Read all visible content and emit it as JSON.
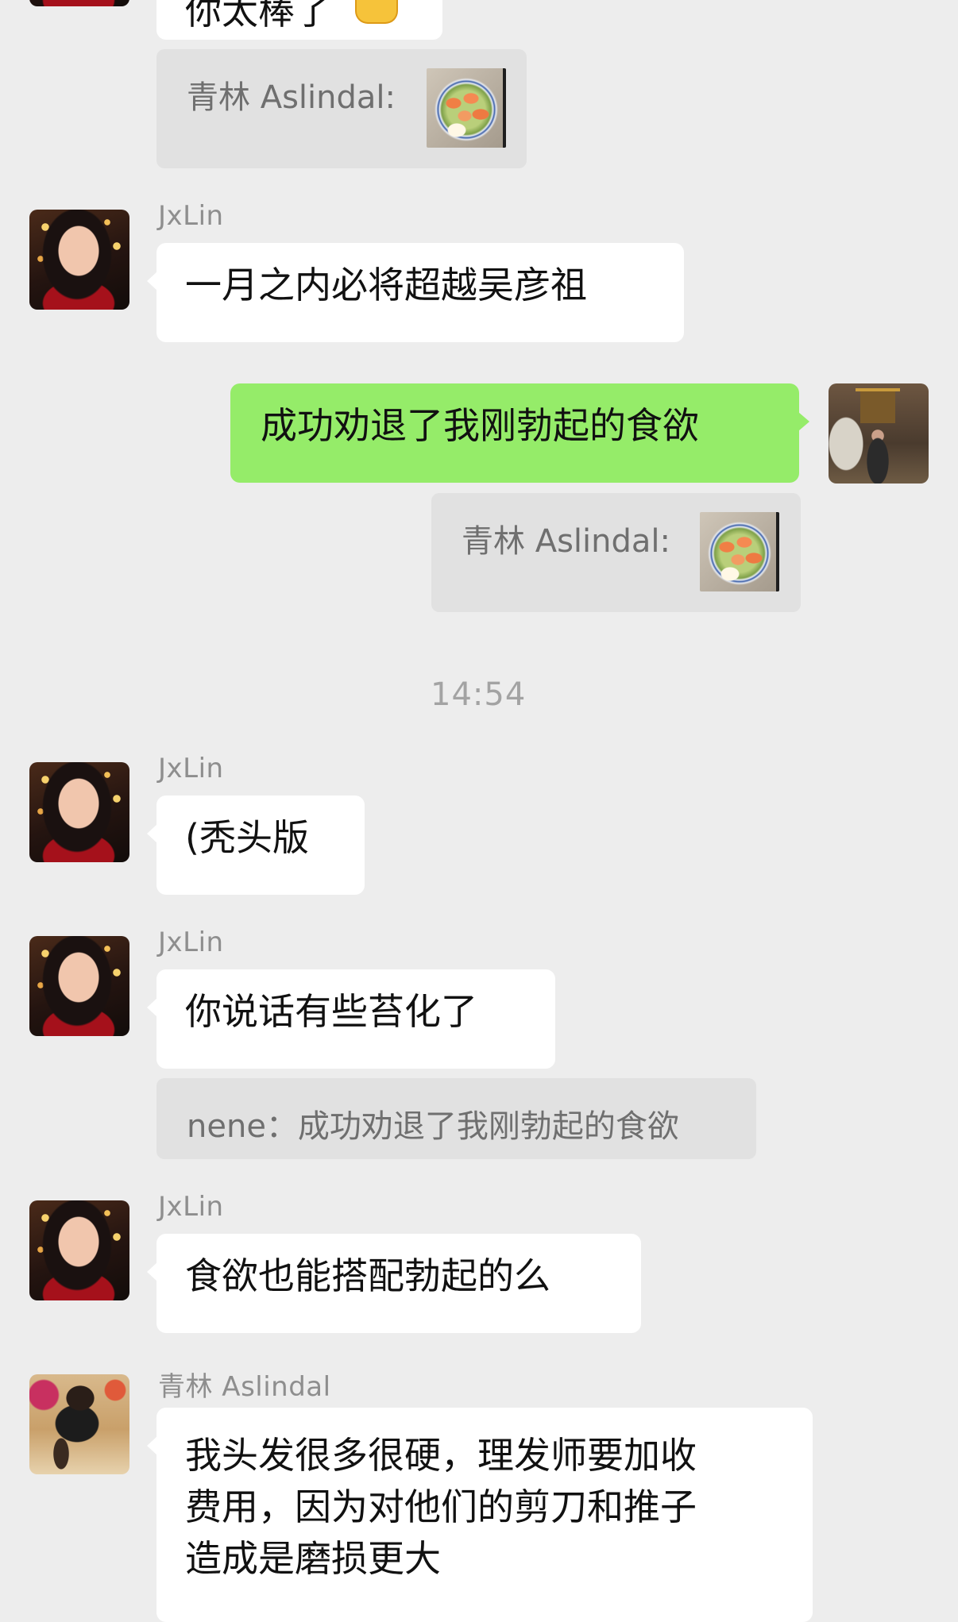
{
  "messages": [
    {
      "id": "m0",
      "text": "你太棒了"
    },
    {
      "id": "m1",
      "quote_sender": "青林 Aslindal:"
    },
    {
      "id": "m2",
      "sender": "JxLin",
      "text": "一月之内必将超越吴彦祖"
    },
    {
      "id": "m3",
      "text": "成功劝退了我刚勃起的食欲",
      "quote_sender": "青林 Aslindal:"
    },
    {
      "id": "m4",
      "sender": "JxLin",
      "text": "(秃头版"
    },
    {
      "id": "m5",
      "sender": "JxLin",
      "text": "你说话有些苔化了",
      "quote": "nene：成功劝退了我刚勃起的食欲"
    },
    {
      "id": "m6",
      "sender": "JxLin",
      "text": "食欲也能搭配勃起的么"
    },
    {
      "id": "m7",
      "sender": "青林 Aslindal",
      "lines": [
        "我头发很多很硬，理发师要加收",
        "费用，因为对他们的剪刀和推子",
        "造成是磨损更大"
      ]
    }
  ],
  "timestamp": "14:54",
  "icons": {
    "quote_image": "food-photo-icon",
    "emoji": "thumbs-up-icon"
  },
  "colors": {
    "background": "#ededed",
    "my_bubble": "#95ec69",
    "other_bubble": "#ffffff",
    "quote_bg": "#e1e1e1"
  }
}
